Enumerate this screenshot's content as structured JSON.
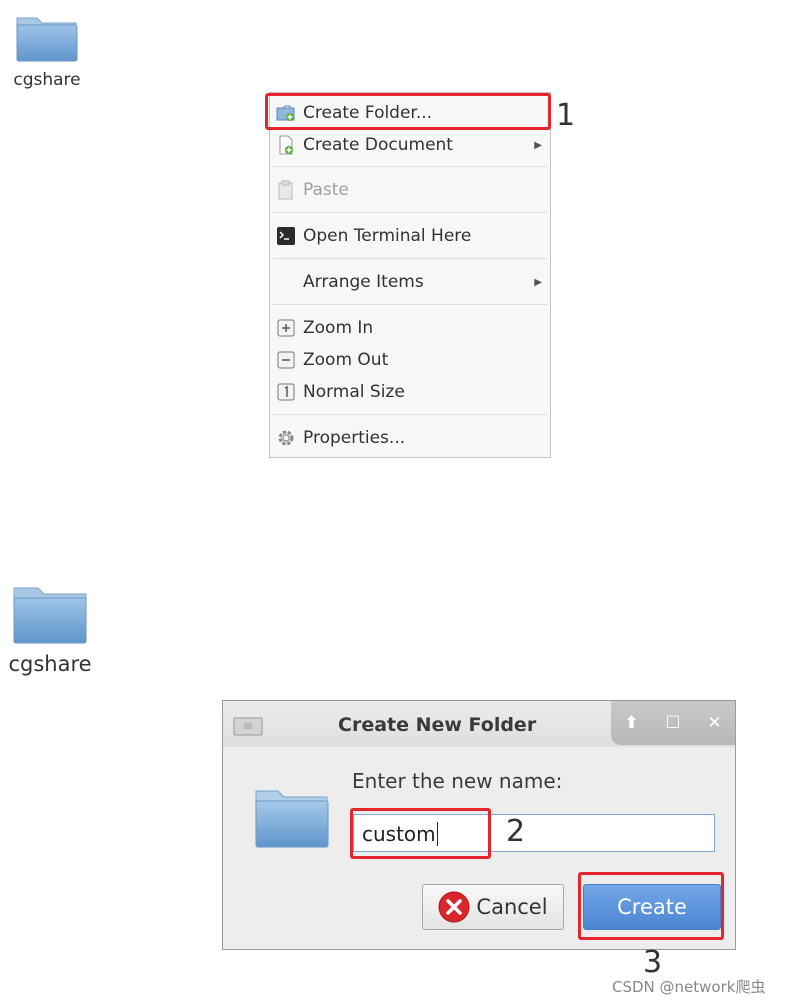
{
  "desktop": {
    "icon_top_label": "cgshare",
    "icon_bottom_label": "cgshare"
  },
  "context_menu": {
    "items": [
      {
        "label": "Create Folder...",
        "icon": "folder-new-icon"
      },
      {
        "label": "Create Document",
        "icon": "document-new-icon",
        "has_submenu": true
      },
      {
        "label": "Paste",
        "icon": "paste-icon",
        "disabled": true
      },
      {
        "label": "Open Terminal Here",
        "icon": "terminal-icon"
      },
      {
        "label": "Arrange Items",
        "has_submenu": true
      },
      {
        "label": "Zoom In",
        "icon": "zoom-in-icon"
      },
      {
        "label": "Zoom Out",
        "icon": "zoom-out-icon"
      },
      {
        "label": "Normal Size",
        "icon": "zoom-normal-icon"
      },
      {
        "label": "Properties...",
        "icon": "gear-icon"
      }
    ]
  },
  "annotations": {
    "step1": "1",
    "step2": "2",
    "step3": "3"
  },
  "dialog": {
    "title": "Create New Folder",
    "prompt": "Enter the new name:",
    "name_value": "custom",
    "cancel_label": "Cancel",
    "create_label": "Create"
  },
  "watermark": "CSDN @network爬虫",
  "colors": {
    "highlight": "#e5262c",
    "create_button": "#5a92dc",
    "folder": "#6fa3d6"
  }
}
